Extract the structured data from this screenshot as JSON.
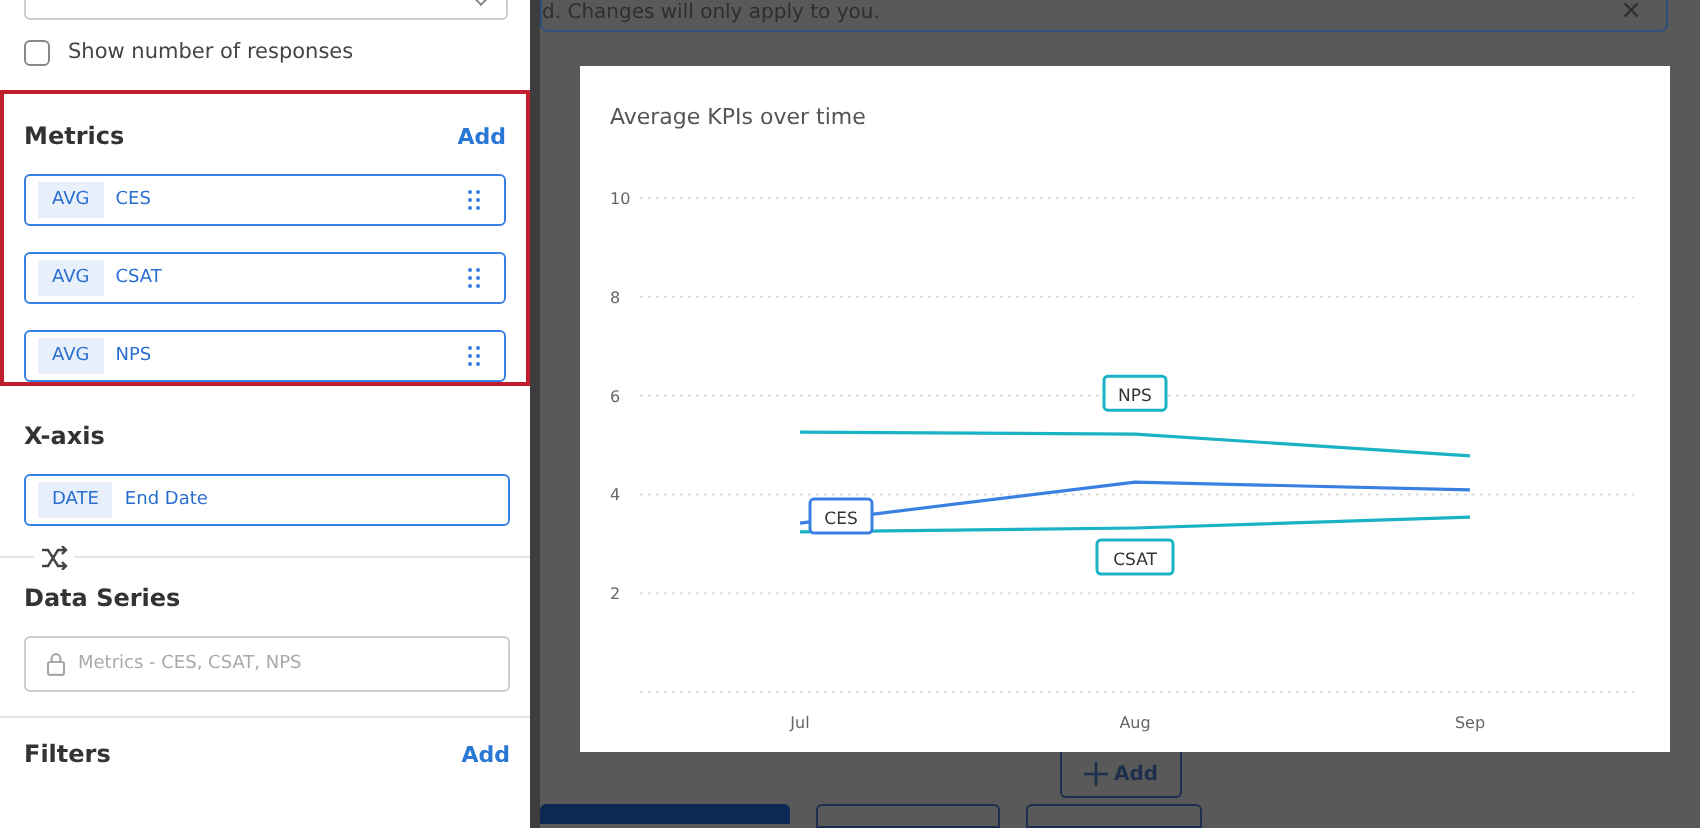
{
  "show_responses": {
    "label": "Show number of responses",
    "checked": false
  },
  "metrics": {
    "title": "Metrics",
    "add": "Add",
    "highlighted": true,
    "items": [
      {
        "aggregation": "AVG",
        "name": "CES"
      },
      {
        "aggregation": "AVG",
        "name": "CSAT"
      },
      {
        "aggregation": "AVG",
        "name": "NPS"
      }
    ]
  },
  "x_axis": {
    "title": "X-axis",
    "item": {
      "type": "DATE",
      "name": "End Date"
    }
  },
  "data_series": {
    "title": "Data Series",
    "placeholder": "Metrics - CES, CSAT, NPS",
    "locked": true
  },
  "filters": {
    "title": "Filters",
    "add": "Add"
  },
  "banner": {
    "text": "d. Changes will only apply to you.",
    "close": "×"
  },
  "chart_card": {
    "title": "Average KPIs over time",
    "chart_data": {
      "type": "line",
      "categories": [
        "Jul",
        "Aug",
        "Sep"
      ],
      "ylim": [
        0,
        10
      ],
      "yticks": [
        2,
        4,
        6,
        8,
        10
      ],
      "grid": true,
      "series": [
        {
          "name": "NPS",
          "color": "#1ab3c6",
          "values": [
            5.26,
            5.22,
            4.78
          ]
        },
        {
          "name": "CES",
          "color": "#3a80e2",
          "values": [
            3.42,
            4.25,
            4.09
          ]
        },
        {
          "name": "CSAT",
          "color": "#1ab3c6",
          "values": [
            3.24,
            3.32,
            3.54
          ]
        }
      ]
    }
  },
  "add_button": {
    "label": "Add"
  }
}
